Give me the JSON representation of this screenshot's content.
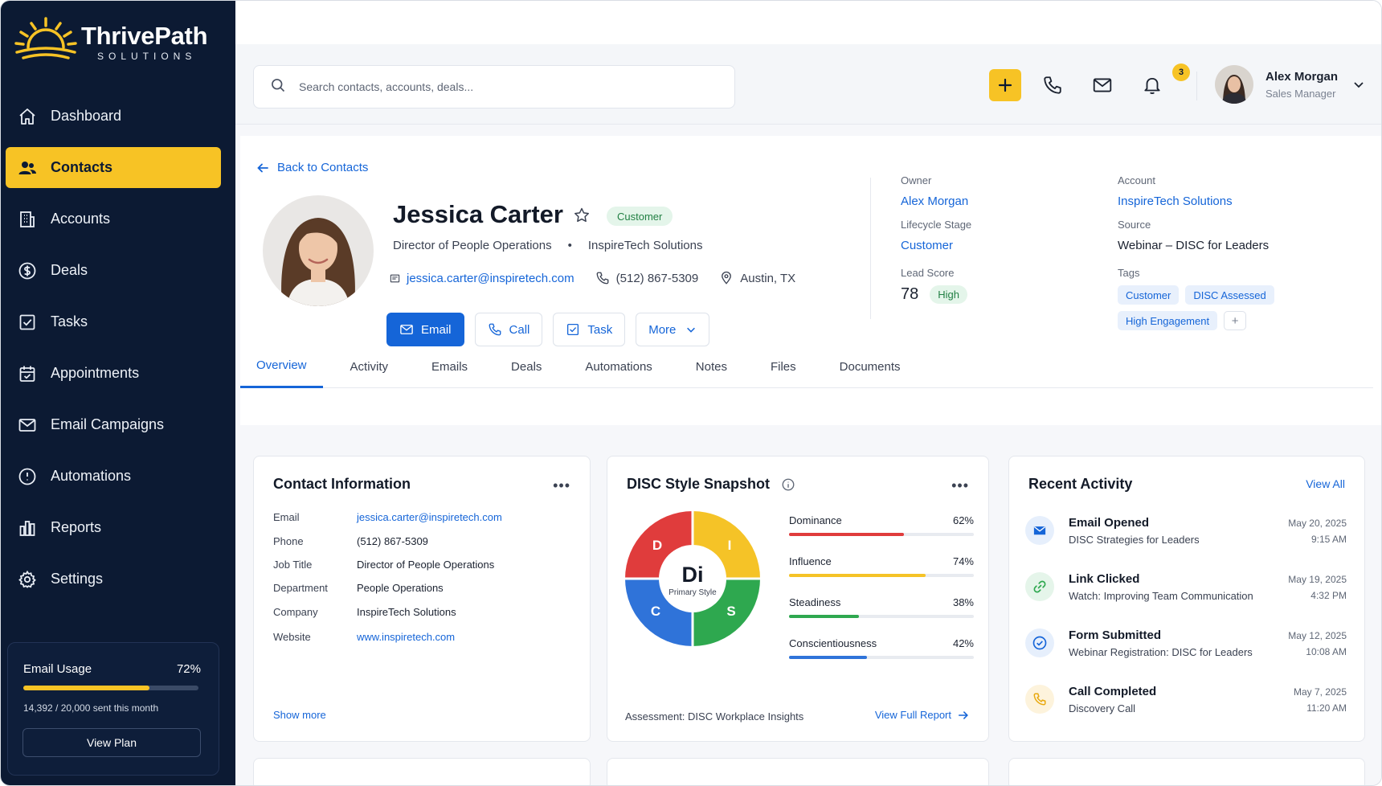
{
  "brand": {
    "name": "ThrivePath",
    "sub": "SOLUTIONS"
  },
  "sidebar": {
    "items": [
      {
        "label": "Dashboard",
        "icon": "home-icon"
      },
      {
        "label": "Contacts",
        "icon": "users-icon",
        "active": true
      },
      {
        "label": "Accounts",
        "icon": "building-icon"
      },
      {
        "label": "Deals",
        "icon": "dollar-icon"
      },
      {
        "label": "Tasks",
        "icon": "checkbox-icon"
      },
      {
        "label": "Appointments",
        "icon": "calendar-icon"
      },
      {
        "label": "Email Campaigns",
        "icon": "mail-icon"
      },
      {
        "label": "Automations",
        "icon": "automation-icon"
      },
      {
        "label": "Reports",
        "icon": "reports-icon"
      },
      {
        "label": "Settings",
        "icon": "gear-icon"
      }
    ],
    "usage": {
      "title": "Email Usage",
      "percent_label": "72%",
      "fraction": 0.72,
      "detail": "14,392 / 20,000 sent this month",
      "button": "View Plan"
    }
  },
  "topbar": {
    "search_placeholder": "Search contacts, accounts, deals...",
    "notification_count": "3",
    "user": {
      "name": "Alex Morgan",
      "role": "Sales Manager"
    }
  },
  "profile": {
    "back_label": "Back to Contacts",
    "name": "Jessica Carter",
    "badge": "Customer",
    "title": "Director of People Operations",
    "company": "InspireTech Solutions",
    "email": "jessica.carter@inspiretech.com",
    "phone": "(512) 867-5309",
    "location": "Austin, TX",
    "actions": {
      "email": "Email",
      "call": "Call",
      "task": "Task",
      "more": "More"
    },
    "meta": {
      "owner_label": "Owner",
      "owner": "Alex Morgan",
      "account_label": "Account",
      "account": "InspireTech Solutions",
      "lifecycle_label": "Lifecycle Stage",
      "lifecycle": "Customer",
      "source_label": "Source",
      "source": "Webinar – DISC for Leaders",
      "score_label": "Lead Score",
      "score": "78",
      "score_level": "High",
      "tags_label": "Tags",
      "tags": [
        "Customer",
        "DISC Assessed",
        "High Engagement"
      ],
      "tag_add": "+"
    }
  },
  "tabs": [
    "Overview",
    "Activity",
    "Emails",
    "Deals",
    "Automations",
    "Notes",
    "Files",
    "Documents"
  ],
  "contact_info": {
    "title": "Contact Information",
    "rows": [
      {
        "k": "Email",
        "v": "jessica.carter@inspiretech.com",
        "link": true
      },
      {
        "k": "Phone",
        "v": "(512) 867-5309"
      },
      {
        "k": "Job Title",
        "v": "Director of People Operations"
      },
      {
        "k": "Department",
        "v": "People Operations"
      },
      {
        "k": "Company",
        "v": "InspireTech Solutions"
      },
      {
        "k": "Website",
        "v": "www.inspiretech.com",
        "link": true
      }
    ],
    "show_more": "Show more"
  },
  "disc": {
    "title": "DISC Style Snapshot",
    "center": "Di",
    "center_sub": "Primary Style",
    "quadrants": {
      "d": "D",
      "i": "I",
      "s": "S",
      "c": "C"
    },
    "colors": {
      "d": "#e03c3c",
      "i": "#f5c327",
      "s": "#2ea84f",
      "c": "#2f73d9"
    },
    "rows": [
      {
        "label": "Dominance",
        "pct_label": "62%",
        "value": 0.62,
        "color": "#e03c3c"
      },
      {
        "label": "Influence",
        "pct_label": "74%",
        "value": 0.74,
        "color": "#f5c327"
      },
      {
        "label": "Steadiness",
        "pct_label": "38%",
        "value": 0.38,
        "color": "#2ea84f"
      },
      {
        "label": "Conscientiousness",
        "pct_label": "42%",
        "value": 0.42,
        "color": "#2f73d9"
      }
    ],
    "footer": "Assessment: DISC Workplace Insights",
    "link": "View Full Report"
  },
  "activity": {
    "title": "Recent Activity",
    "view_all": "View All",
    "items": [
      {
        "title": "Email Opened",
        "detail": "DISC Strategies for Leaders",
        "date": "May 20, 2025",
        "time": "9:15 AM",
        "icon": "mail-icon"
      },
      {
        "title": "Link Clicked",
        "detail": "Watch: Improving Team Communication",
        "date": "May 19, 2025",
        "time": "4:32 PM",
        "icon": "link-icon"
      },
      {
        "title": "Form Submitted",
        "detail": "Webinar Registration: DISC for Leaders",
        "date": "May 12, 2025",
        "time": "10:08 AM",
        "icon": "check-circle-icon"
      },
      {
        "title": "Call Completed",
        "detail": "Discovery Call",
        "date": "May 7, 2025",
        "time": "11:20 AM",
        "icon": "phone-icon"
      }
    ]
  }
}
